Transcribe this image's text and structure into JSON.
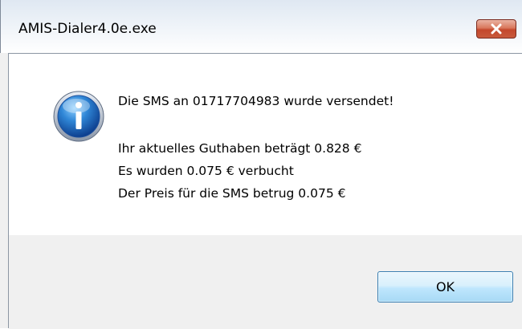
{
  "window": {
    "title": "AMIS-Dialer4.0e.exe",
    "close_icon": "close-icon"
  },
  "dialog": {
    "icon": "info-icon",
    "message_main": "Die SMS an 01717704983 wurde versendet!",
    "details": [
      "Ihr aktuelles Guthaben beträgt  0.828 €",
      "Es wurden 0.075 €  verbucht",
      "Der Preis für die SMS betrug  0.075 €"
    ],
    "ok_label": "OK"
  },
  "colors": {
    "dialog_background": "#f0f0f0",
    "content_background": "#ffffff",
    "close_button": "#c4482c",
    "ok_button_border": "#3c7fb1"
  }
}
